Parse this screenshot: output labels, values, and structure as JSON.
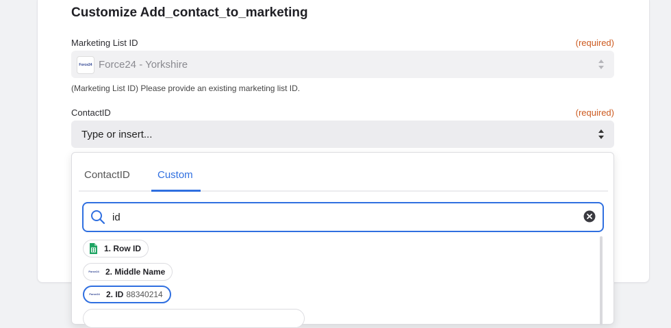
{
  "page": {
    "title": "Customize Add_contact_to_marketing"
  },
  "marketing_list": {
    "label": "Marketing List ID",
    "required": "(required)",
    "value": "Force24 - Yorkshire",
    "logo_text": "Force24",
    "help": "(Marketing List ID) Please provide an existing marketing list ID."
  },
  "contact": {
    "label": "ContactID",
    "required": "(required)",
    "placeholder": "Type or insert..."
  },
  "dropdown": {
    "tabs": [
      {
        "label": "ContactID",
        "active": false
      },
      {
        "label": "Custom",
        "active": true
      }
    ],
    "search_value": "id",
    "options": [
      {
        "label": "1. Row ID",
        "value": "",
        "icon": "google-sheets-icon"
      },
      {
        "label": "2. Middle Name",
        "value": "",
        "icon": "force24-logo"
      },
      {
        "label": "2. ID",
        "value": "88340214",
        "icon": "force24-logo"
      }
    ]
  },
  "colors": {
    "accent": "#2f6fe0",
    "required": "#cc5a1f",
    "sheets_green": "#1fa463"
  }
}
